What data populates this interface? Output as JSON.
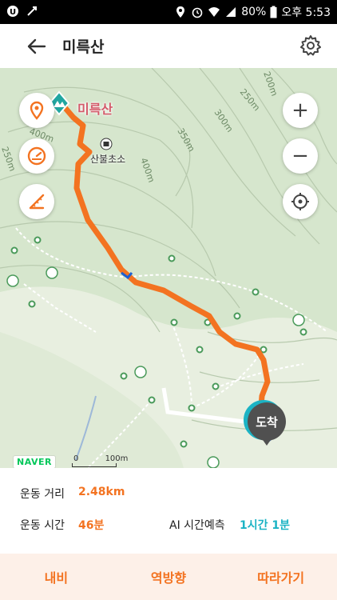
{
  "status_bar": {
    "battery": "80%",
    "time": "오후 5:53",
    "icons": [
      "talk-icon",
      "usb-icon",
      "location-icon",
      "alarm-icon",
      "wifi-icon",
      "signal-icon",
      "battery-icon"
    ]
  },
  "header": {
    "title": "미륵산",
    "back_icon": "arrow-left-icon",
    "settings_icon": "gear-icon"
  },
  "map": {
    "peak_label": "미륵산",
    "shelter_label": "산불초소",
    "arrival_label": "도착",
    "naver_logo": "NAVER",
    "scale_zero": "0",
    "scale_label": "100m",
    "contour_labels": [
      "400m",
      "400m",
      "350m",
      "300m",
      "250m",
      "200m",
      "250m"
    ],
    "zoom_in_label": "+",
    "zoom_out_label": "−",
    "route_color": "#f37321"
  },
  "stats": {
    "distance_label": "운동 거리",
    "distance_value": "2.48km",
    "time_label": "운동 시간",
    "time_value": "46분",
    "ai_label": "AI 시간예측",
    "ai_value": "1시간 1분"
  },
  "actions": {
    "navi": "내비",
    "reverse": "역방향",
    "follow": "따라가기"
  },
  "colors": {
    "accent": "#f37321",
    "teal": "#1bb3c4",
    "map_bg": "#e8efe0"
  }
}
